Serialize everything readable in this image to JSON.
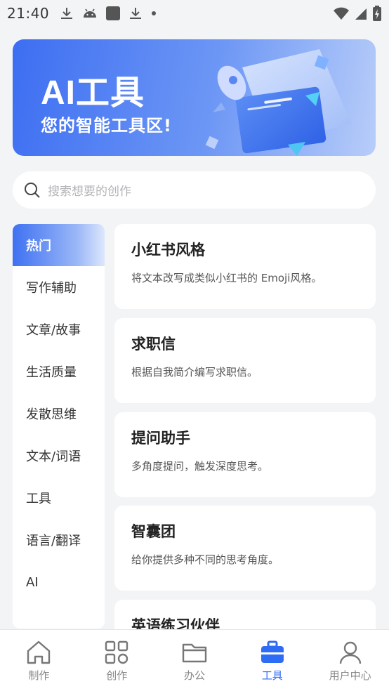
{
  "status_bar": {
    "time": "21:40",
    "left_icons": [
      "download-icon",
      "android-icon",
      "app-square-icon",
      "download-icon",
      "dot-icon"
    ],
    "right_icons": [
      "wifi-icon",
      "signal-icon",
      "battery-charging-icon"
    ]
  },
  "banner": {
    "title": "AI工具",
    "subtitle": "您的智能工具区!"
  },
  "search": {
    "placeholder": "搜索想要的创作"
  },
  "sidebar": {
    "items": [
      {
        "label": "热门",
        "active": true
      },
      {
        "label": "写作辅助"
      },
      {
        "label": "文章/故事"
      },
      {
        "label": "生活质量"
      },
      {
        "label": "发散思维"
      },
      {
        "label": "文本/词语"
      },
      {
        "label": "工具"
      },
      {
        "label": "语言/翻译"
      },
      {
        "label": "AI"
      }
    ]
  },
  "cards": [
    {
      "title": "小红书风格",
      "desc": "将文本改写成类似小红书的 Emoji风格。"
    },
    {
      "title": "求职信",
      "desc": "根据自我简介编写求职信。"
    },
    {
      "title": "提问助手",
      "desc": "多角度提问，触发深度思考。"
    },
    {
      "title": "智囊团",
      "desc": "给你提供多种不同的思考角度。"
    },
    {
      "title": "英语练习伙伴",
      "desc": ""
    }
  ],
  "bottom_nav": {
    "items": [
      {
        "label": "制作",
        "icon": "home-icon"
      },
      {
        "label": "创作",
        "icon": "grid-icon"
      },
      {
        "label": "办公",
        "icon": "folder-icon"
      },
      {
        "label": "工具",
        "icon": "toolbox-icon",
        "active": true
      },
      {
        "label": "用户中心",
        "icon": "user-icon"
      }
    ]
  },
  "colors": {
    "accent": "#2f6cf6",
    "background": "#f3f4f6"
  }
}
